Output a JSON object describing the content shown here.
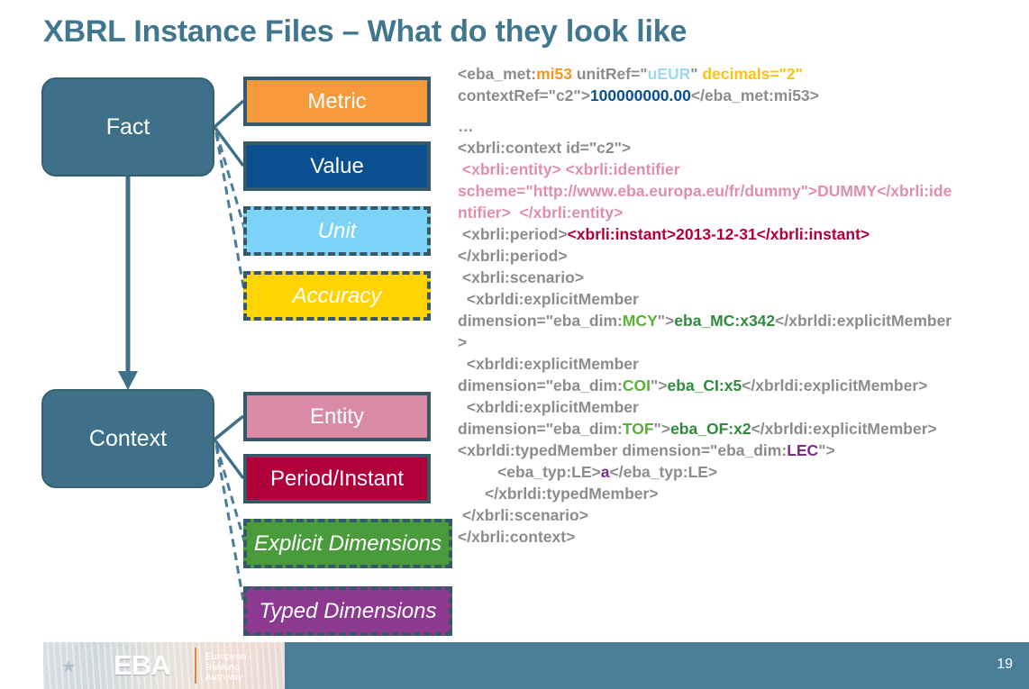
{
  "slide": {
    "title": "XBRL Instance Files – What do they look like",
    "page_number": "19",
    "accent_color": "#40778F"
  },
  "diagram": {
    "nodes": [
      {
        "label": "Fact"
      },
      {
        "label": "Context"
      }
    ],
    "fact_attributes": [
      {
        "label": "Metric",
        "color": "#F79A3C",
        "style": "solid"
      },
      {
        "label": "Value",
        "color": "#0A4F8F",
        "style": "solid"
      },
      {
        "label": "Unit",
        "color": "#7DD3F7",
        "style": "dashed"
      },
      {
        "label": "Accuracy",
        "color": "#FFD400",
        "style": "dashed"
      }
    ],
    "context_attributes": [
      {
        "label": "Entity",
        "color": "#D98BA5",
        "style": "solid"
      },
      {
        "label": "Period/Instant",
        "color": "#B0003A",
        "style": "solid"
      },
      {
        "label": "Explicit Dimensions",
        "color": "#4A9B3C",
        "style": "dashed"
      },
      {
        "label": "Typed Dimensions",
        "color": "#8B3A8F",
        "style": "dashed"
      }
    ]
  },
  "code": {
    "l1a": "<eba_met:",
    "l1b": "mi53",
    "l1c": " unitRef=\"",
    "l1d": "uEUR",
    "l1e": "\" ",
    "l1f": "decimals=\"2\"",
    "l2a": "contextRef=\"c2\">",
    "l2b": "100000000.00",
    "l2c": "</eba_met:mi53>",
    "l3": "…",
    "l4": "<xbrli:context id=\"c2\">",
    "l5": " <xbrli:entity> <xbrli:identifier",
    "l6": "scheme=\"http://www.eba.europa.eu/fr/dummy\">DUMMY</xbrli:ide",
    "l7": "ntifier>  </xbrli:entity>",
    "l8a": " <xbrli:period>",
    "l8b": "<xbrli:instant>2013-12-31</xbrli:instant>",
    "l9": "</xbrli:period>",
    "l10": " <xbrli:scenario>",
    "l11": "  <xbrldi:explicitMember",
    "l12a": "dimension=\"eba_dim:",
    "l12b": "MCY",
    "l12c": "\">",
    "l12d": "eba_MC:x342",
    "l12e": "</xbrldi:explicitMember",
    "l13": ">",
    "l14": "  <xbrldi:explicitMember",
    "l15a": "dimension=\"eba_dim:",
    "l15b": "COI",
    "l15c": "\">",
    "l15d": "eba_CI:x5",
    "l15e": "</xbrldi:explicitMember>",
    "l16": "  <xbrldi:explicitMember",
    "l17a": "dimension=\"eba_dim:",
    "l17b": "TOF",
    "l17c": "\">",
    "l17d": "eba_OF:x2",
    "l17e": "</xbrldi:explicitMember>",
    "l18a": "<xbrldi:typedMember dimension=\"eba_dim:",
    "l18b": "LEC",
    "l18c": "\">",
    "l19a": "<eba_typ:LE>",
    "l19b": "a",
    "l19c": "</eba_typ:LE>",
    "l20": "</xbrldi:typedMember>",
    "l21": " </xbrli:scenario>",
    "l22": "</xbrli:context>"
  },
  "footer": {
    "org_abbr": "EBA",
    "org_line1": "European",
    "org_line2": "Banking",
    "org_line3": "Authority"
  }
}
